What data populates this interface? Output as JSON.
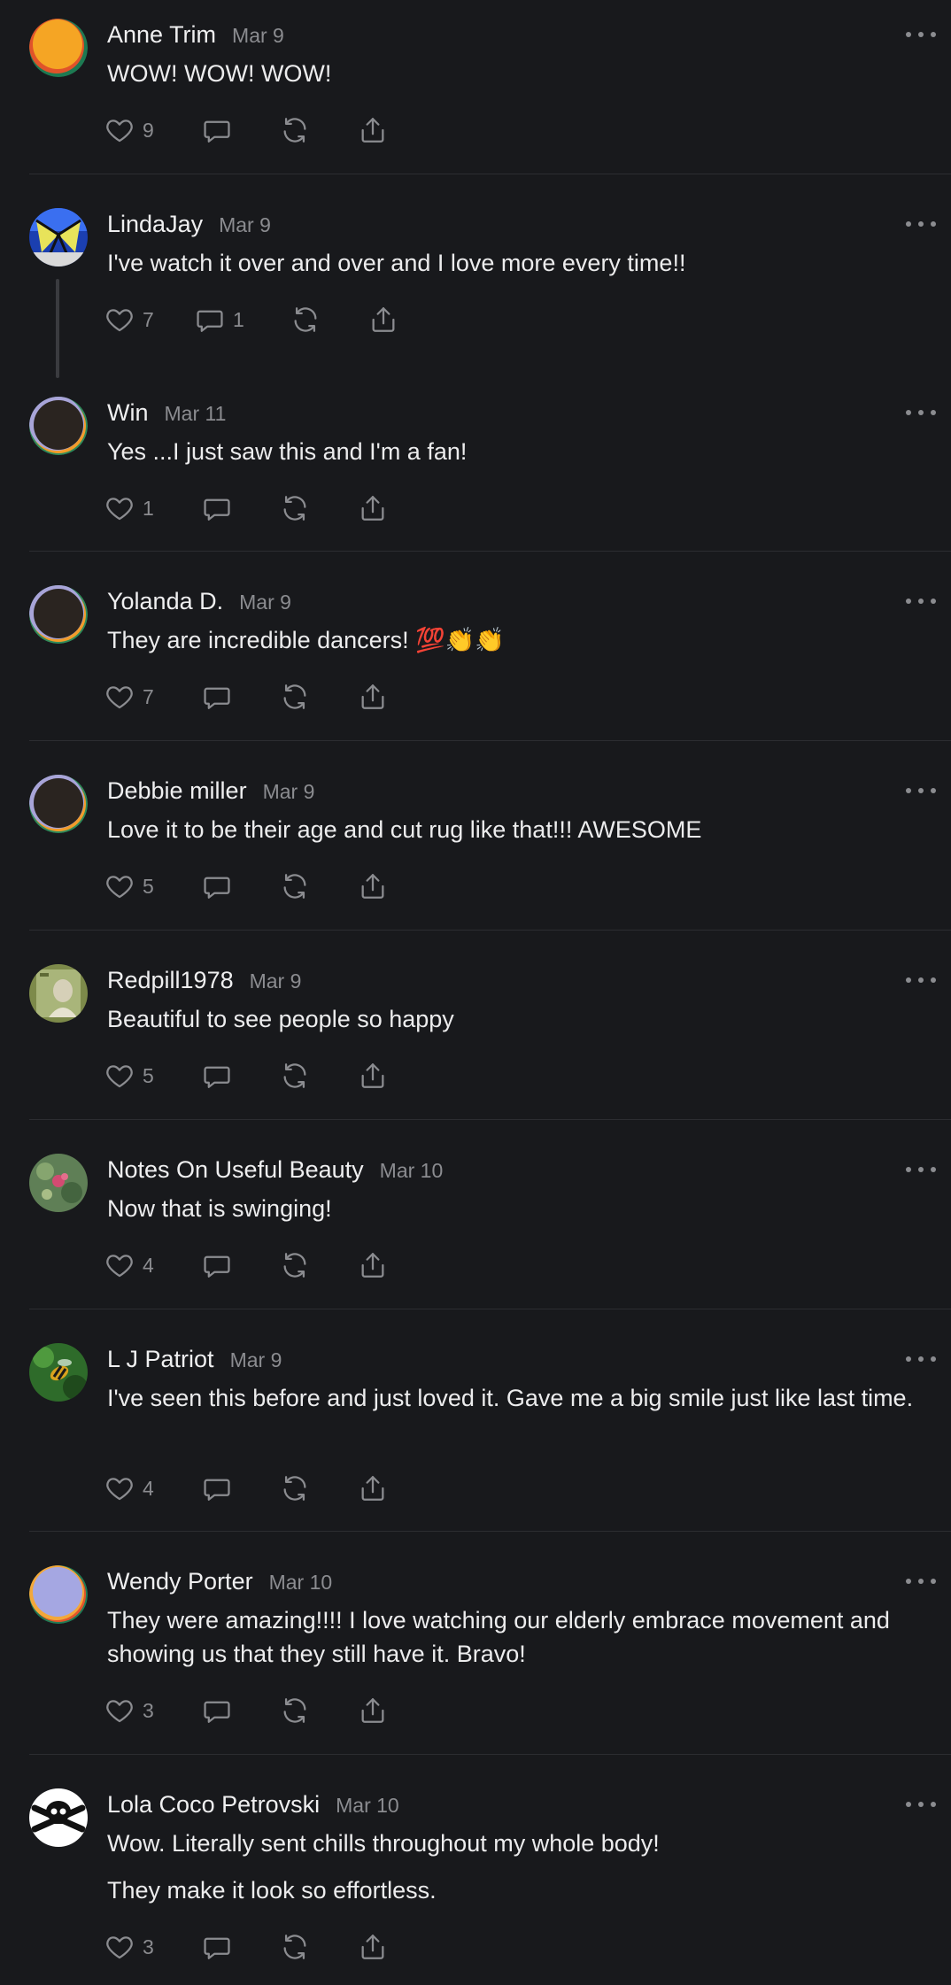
{
  "comments": [
    {
      "name": "Anne Trim",
      "date": "Mar 9",
      "text": [
        "WOW! WOW! WOW!"
      ],
      "likes": "9",
      "replies": "",
      "avatar": "orange-gradient"
    },
    {
      "name": "LindaJay",
      "date": "Mar 9",
      "text": [
        "I've watch it over and over and I love more every time!!"
      ],
      "likes": "7",
      "replies": "1",
      "avatar": "butterfly-photo"
    },
    {
      "name": "Win",
      "date": "Mar 11",
      "text": [
        "Yes ...I just saw this and I'm a fan!"
      ],
      "likes": "1",
      "replies": "",
      "avatar": "dark-gradient"
    },
    {
      "name": "Yolanda D.",
      "date": "Mar 9",
      "text": [
        "They are incredible dancers! 💯👏👏"
      ],
      "likes": "7",
      "replies": "",
      "avatar": "dark-gradient"
    },
    {
      "name": "Debbie miller",
      "date": "Mar 9",
      "text": [
        "Love it to be their age and cut rug like that!!! AWESOME"
      ],
      "likes": "5",
      "replies": "",
      "avatar": "dark-gradient"
    },
    {
      "name": "Redpill1978",
      "date": "Mar 9",
      "text": [
        "Beautiful to see people so happy"
      ],
      "likes": "5",
      "replies": "",
      "avatar": "stamp-photo"
    },
    {
      "name": "Notes On Useful Beauty",
      "date": "Mar 10",
      "text": [
        "Now that is swinging!"
      ],
      "likes": "4",
      "replies": "",
      "avatar": "flower-photo"
    },
    {
      "name": "L J Patriot",
      "date": "Mar 9",
      "text": [
        "I've seen this before and just loved it. Gave me a big smile just like last time."
      ],
      "likes": "4",
      "replies": "",
      "avatar": "bee-photo"
    },
    {
      "name": "Wendy Porter",
      "date": "Mar 10",
      "text": [
        "They were amazing!!!! I love watching our elderly embrace movement and showing us that they still have it. Bravo!"
      ],
      "likes": "3",
      "replies": "",
      "avatar": "lavender-gradient"
    },
    {
      "name": "Lola Coco Petrovski",
      "date": "Mar 10",
      "text": [
        "Wow. Literally sent chills throughout my whole body!",
        "They make it look so effortless."
      ],
      "likes": "3",
      "replies": "",
      "avatar": "skull-bw"
    }
  ],
  "icons": {
    "like": "heart-icon",
    "reply": "comment-bubble-icon",
    "restack": "refresh-icon",
    "share": "share-icon",
    "more": "more-options-icon"
  },
  "colors": {
    "background": "#18191c",
    "name": "#efeff0",
    "meta": "#8b8c90",
    "divider": "#2c2d31"
  }
}
